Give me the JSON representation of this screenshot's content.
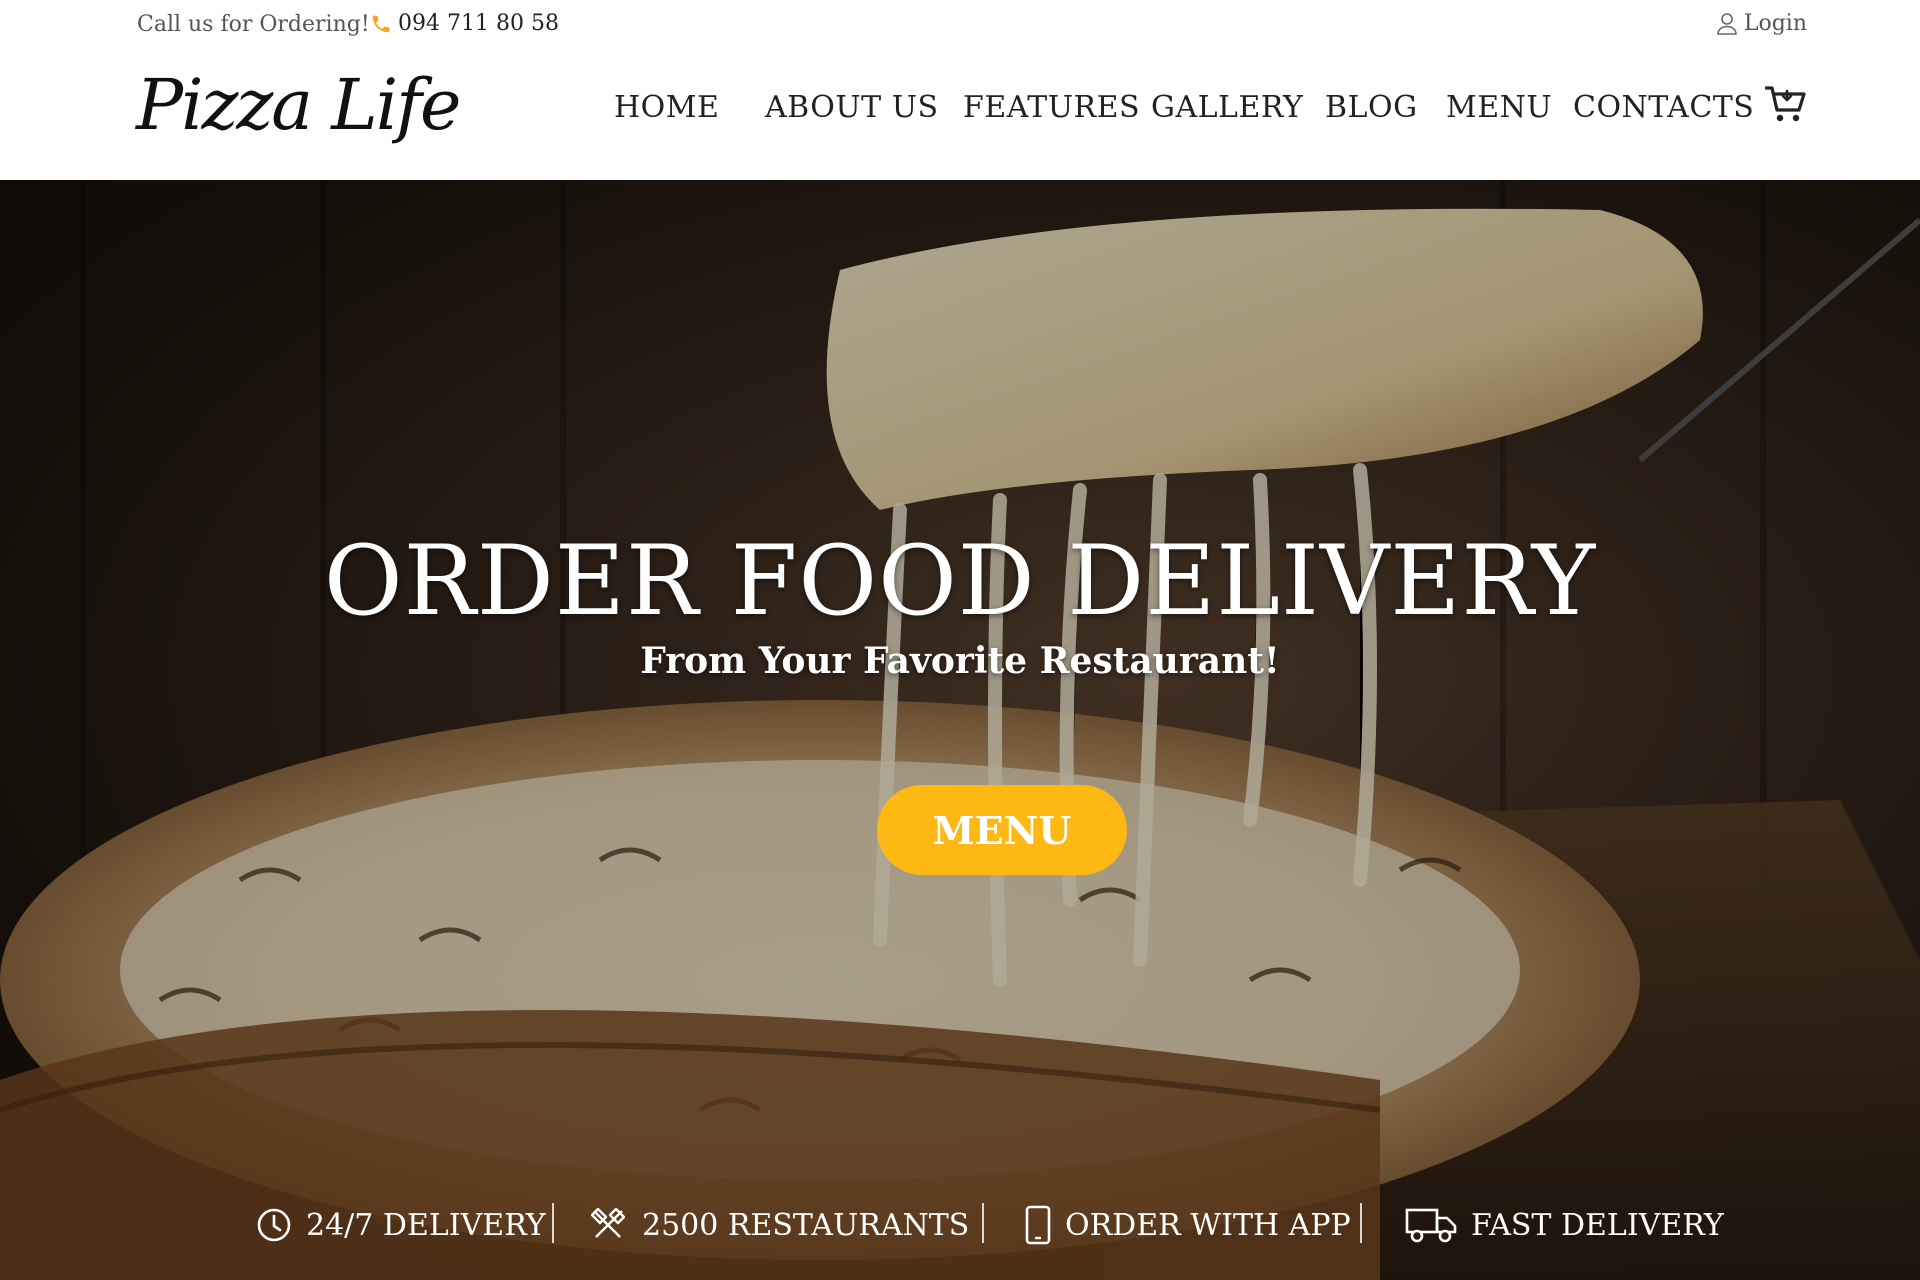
{
  "topbar": {
    "call_text": "Call us for Ordering!",
    "phone": "094 711 80 58",
    "login_label": "Login",
    "phone_icon": "phone-icon",
    "login_icon": "user-icon"
  },
  "header": {
    "logo": "Pizza Life",
    "nav": [
      "HOME",
      "ABOUT US",
      "FEATURES",
      "GALLERY",
      "BLOG",
      "MENU",
      "CONTACTS"
    ],
    "cart_icon": "cart-icon"
  },
  "hero": {
    "headline": "ORDER FOOD DELIVERY",
    "subline": "From Your Favorite Restaurant!",
    "button_label": "MENU",
    "button_color": "#fdb813"
  },
  "features": [
    {
      "label": "24/7 DELIVERY",
      "icon": "clock-icon"
    },
    {
      "label": "2500 RESTAURANTS",
      "icon": "utensils-icon"
    },
    {
      "label": "ORDER WITH APP",
      "icon": "smartphone-icon"
    },
    {
      "label": "FAST DELIVERY",
      "icon": "truck-icon"
    }
  ],
  "colors": {
    "accent": "#fdb813",
    "phone_icon": "#f5a623"
  }
}
